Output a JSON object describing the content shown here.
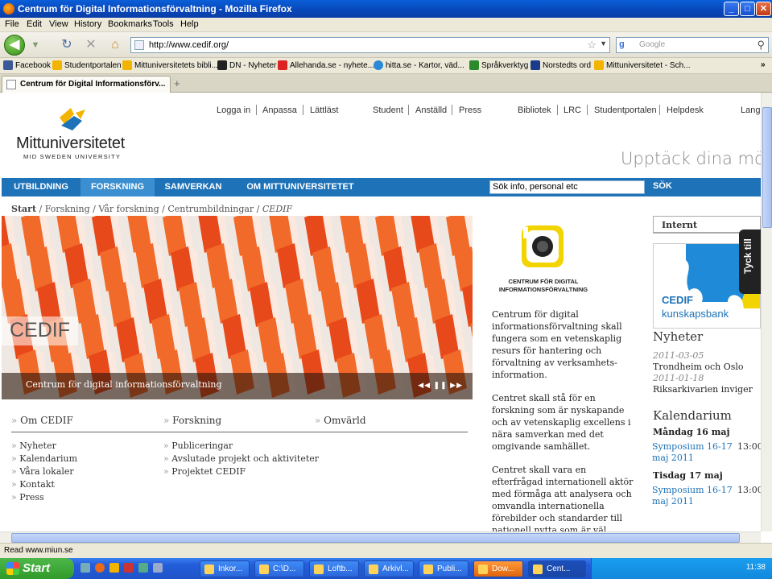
{
  "window": {
    "title": "Centrum för Digital Informationsförvaltning - Mozilla Firefox",
    "minimize": "_",
    "maximize": "□",
    "close": "✕"
  },
  "menu": [
    "File",
    "Edit",
    "View",
    "History",
    "Bookmarks",
    "Tools",
    "Help"
  ],
  "nav": {
    "url": "http://www.cedif.org/",
    "search_placeholder": "Google",
    "back": "◀",
    "reload": "↻",
    "stop": "✕",
    "home": "⌂",
    "star": "☆",
    "dropdown": "▼",
    "glass": "⚲"
  },
  "bookmarks": [
    {
      "label": "Facebook",
      "color": "#3b5998"
    },
    {
      "label": "Studentportalen",
      "color": "#f2b400"
    },
    {
      "label": "Mittuniversitetets bibli...",
      "color": "#f2b400"
    },
    {
      "label": "DN - Nyheter",
      "color": "#222222"
    },
    {
      "label": "Allehanda.se - nyhete...",
      "color": "#d22"
    },
    {
      "label": "hitta.se - Kartor, väd...",
      "color": "#2a8ad8"
    },
    {
      "label": "Språkverktyg",
      "color": "#2c8a2c"
    },
    {
      "label": "Norstedts ord",
      "color": "#1b3b8a"
    },
    {
      "label": "Mittuniversitetet - Sch...",
      "color": "#f2b400"
    }
  ],
  "bookmarks_more": "»",
  "tab": {
    "title": "Centrum för Digital Informationsförv...",
    "new": "+"
  },
  "site": {
    "toplinks_left": [
      "Logga in",
      "Anpassa",
      "Lättläst"
    ],
    "toplinks_mid": [
      "Student",
      "Anställd",
      "Press"
    ],
    "toplinks_right": [
      "Bibliotek",
      "LRC",
      "Studentportalen",
      "Helpdesk",
      "Lang"
    ],
    "logo_name": "Mittuniversitetet",
    "logo_sub": "MID SWEDEN UNIVERSITY",
    "tagline": "Upptäck dina möjligheter",
    "mainnav": [
      "UTBILDNING",
      "FORSKNING",
      "SAMVERKAN",
      "OM MITTUNIVERSITETET"
    ],
    "search_value": "Sök info, personal etc",
    "search_button": "SÖK",
    "breadcrumb_start": "Start",
    "breadcrumb_rest": " / Forskning / Vår forskning / Centrumbildningar / ",
    "breadcrumb_current": "CEDIF",
    "hero_title": "CEDIF",
    "hero_caption": "Centrum för digital informationsförvaltning",
    "hero_controls": "◀◀ ❚❚ ▶▶",
    "columns": [
      {
        "head": "Om CEDIF",
        "items": [
          "Nyheter",
          "Kalendarium",
          "Våra lokaler",
          "Kontakt",
          "Press"
        ]
      },
      {
        "head": "Forskning",
        "items": [
          "Publiceringar",
          "Avslutade projekt och aktiviteter",
          "Projektet CEDIF"
        ]
      },
      {
        "head": "Omvärld",
        "items": []
      }
    ],
    "bullet": "»",
    "cedif_logo_lines": [
      "CENTRUM FÖR DIGITAL",
      "INFORMATIONSFÖRVALTNING"
    ],
    "paragraphs": [
      "Centrum för digital informationsförvaltning skall fungera som en vetenskaplig resurs för hantering och förvaltning av verksamhets-information.",
      "Centret skall stå för en forskning som är nyskapande och av vetenskaplig excellens i nära samverkan med det omgivande samhället.",
      "Centret skall vara en efterfrågad internationell aktör med förmåga att analysera och omvandla internationella förebilder och standarder till nationell nytta som är väl integrerad i en svensk tradition."
    ],
    "internt": "Internt",
    "kbank": {
      "line1": "CEDIF",
      "line2": "kunskapsbank"
    },
    "tyck": "Tyck till",
    "nyheter_head": "Nyheter",
    "news": [
      {
        "date": "2011-03-05",
        "text": "Trondheim och Oslo"
      },
      {
        "date": "2011-01-18",
        "text": "Riksarkivarien inviger"
      }
    ],
    "kalendarium_head": "Kalendarium",
    "events": [
      {
        "day": "Måndag 16 maj",
        "title": "Symposium 16-17 maj 2011",
        "time": "13:00"
      },
      {
        "day": "Tisdag 17 maj",
        "title": "Symposium 16-17 maj 2011",
        "time": "13:00"
      }
    ]
  },
  "status": "Read www.miun.se",
  "taskbar": {
    "start": "Start",
    "buttons": [
      "Inkor...",
      "C:\\D...",
      "Loftb...",
      "Arkivl...",
      "Publi...",
      "Dow...",
      "Cent..."
    ],
    "clock": "11:38"
  }
}
